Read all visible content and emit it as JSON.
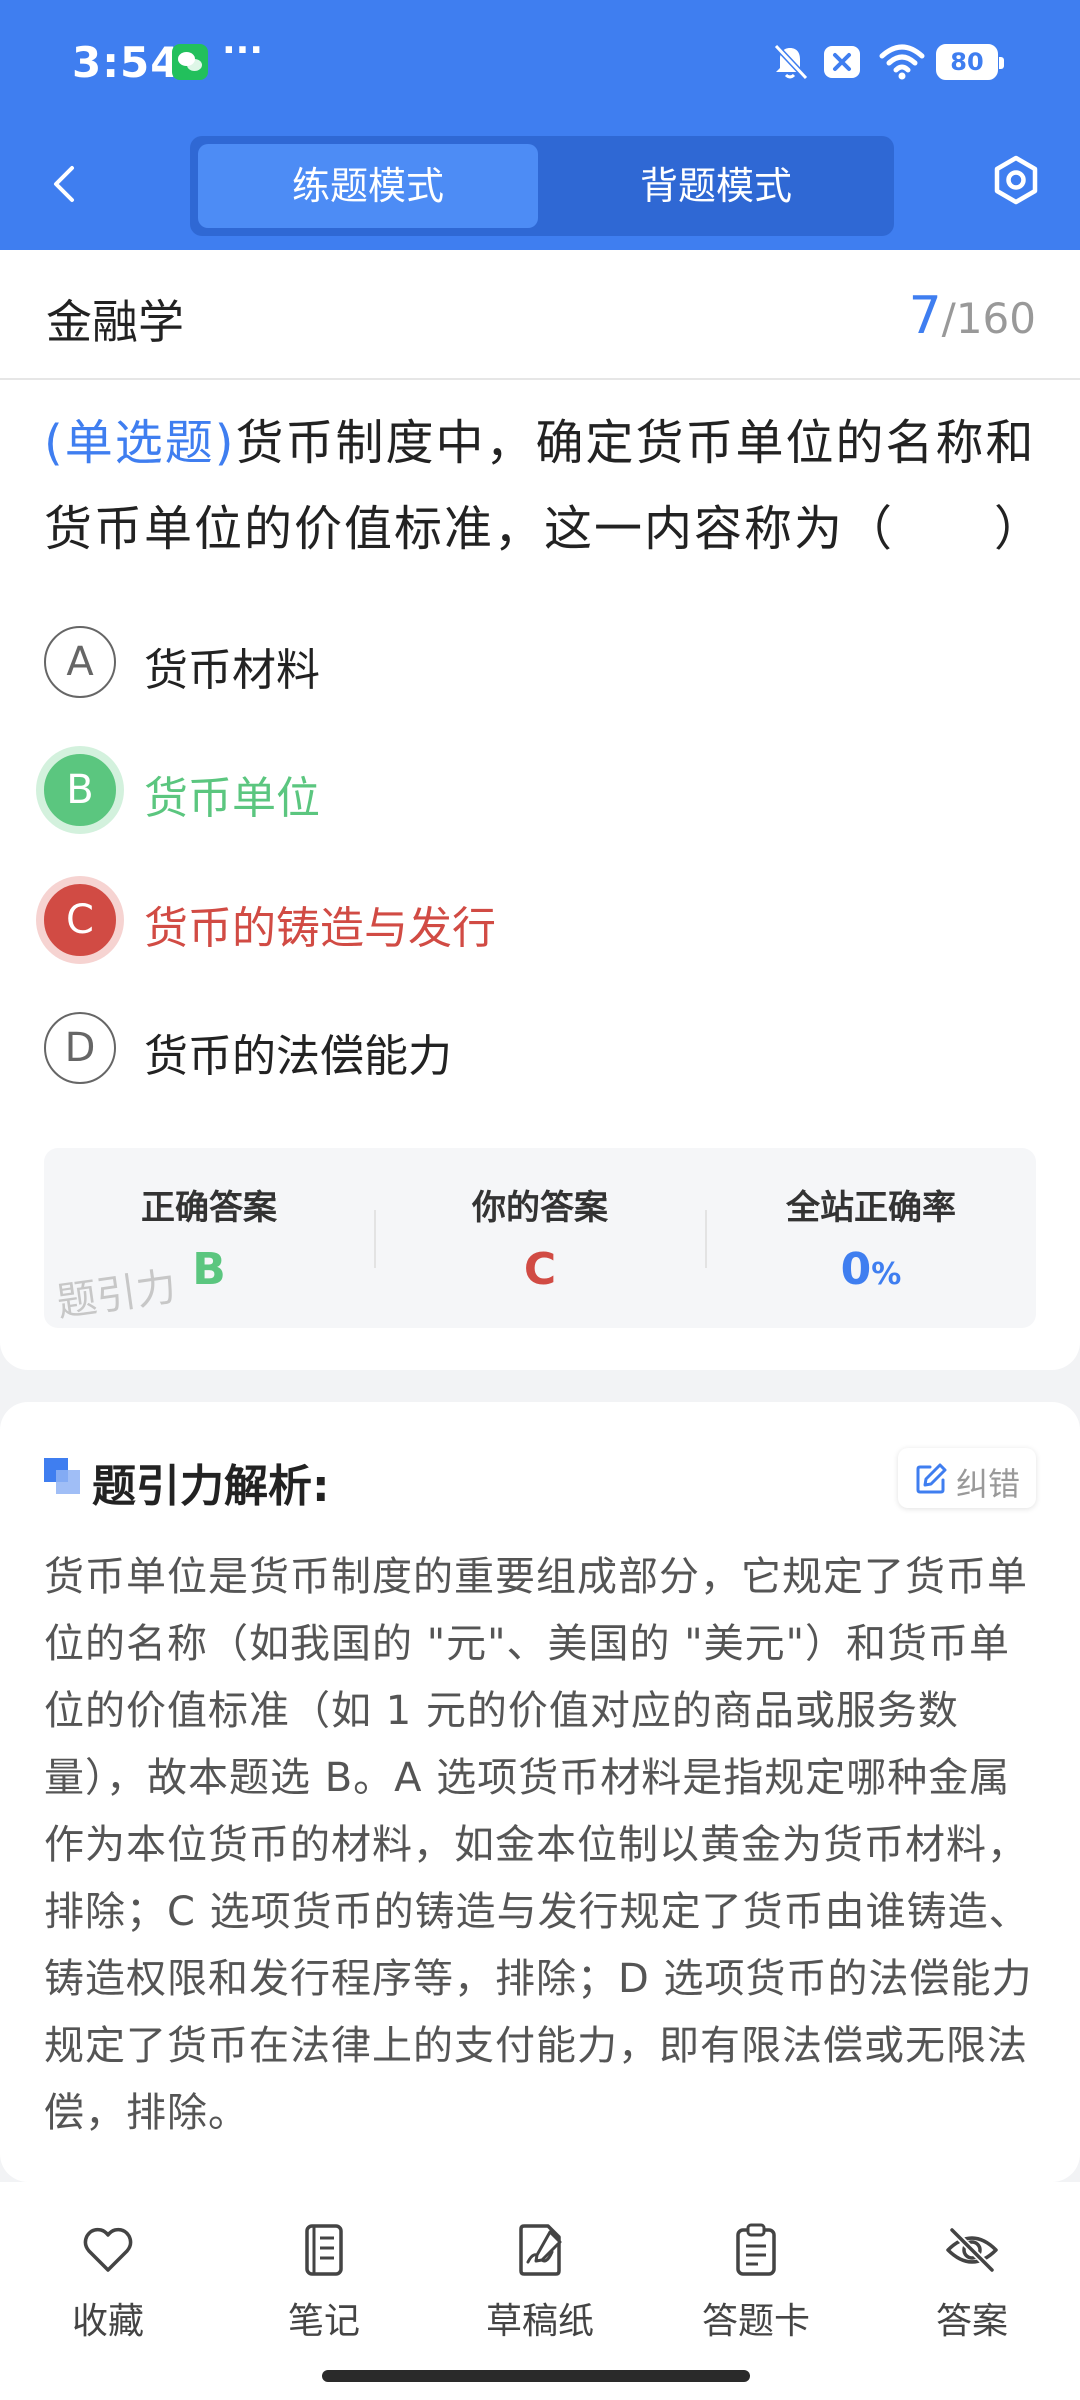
{
  "status_bar": {
    "time": "3:54",
    "more": "···",
    "battery": "80"
  },
  "nav": {
    "tab_practice": "练题模式",
    "tab_memorize": "背题模式"
  },
  "subject": {
    "title": "金融学",
    "current": "7",
    "total": "/160"
  },
  "question": {
    "type": "(单选题)",
    "text": "货币制度中，确定货币单位的名称和货币单位的价值标准，这一内容称为（　　）"
  },
  "options": [
    {
      "letter": "A",
      "text": "货币材料",
      "state": "normal"
    },
    {
      "letter": "B",
      "text": "货币单位",
      "state": "correct"
    },
    {
      "letter": "C",
      "text": "货币的铸造与发行",
      "state": "wrong"
    },
    {
      "letter": "D",
      "text": "货币的法偿能力",
      "state": "normal"
    }
  ],
  "answers": {
    "correct_label": "正确答案",
    "correct_value": "B",
    "yours_label": "你的答案",
    "yours_value": "C",
    "rate_label": "全站正确率",
    "rate_value": "0",
    "rate_unit": "%",
    "watermark": "题引力"
  },
  "analysis": {
    "title": "题引力解析:",
    "correct_button": "纠错",
    "text": "货币单位是货币制度的重要组成部分，它规定了货币单位的名称（如我国的 \"元\"、美国的 \"美元\"）和货币单位的价值标准（如 1 元的价值对应的商品或服务数量），故本题选 B。A 选项货币材料是指规定哪种金属作为本位货币的材料，如金本位制以黄金为货币材料，排除；C 选项货币的铸造与发行规定了货币由谁铸造、铸造权限和发行程序等，排除；D 选项货币的法偿能力规定了货币在法律上的支付能力，即有限法偿或无限法偿，排除。"
  },
  "bottom_bar": [
    {
      "label": "收藏",
      "icon": "heart-icon"
    },
    {
      "label": "笔记",
      "icon": "notebook-icon"
    },
    {
      "label": "草稿纸",
      "icon": "draft-paper-icon"
    },
    {
      "label": "答题卡",
      "icon": "answer-card-icon"
    },
    {
      "label": "答案",
      "icon": "eye-off-icon"
    }
  ],
  "colors": {
    "primary": "#3f7ef0",
    "correct": "#5bc67f",
    "wrong": "#d14b44"
  }
}
